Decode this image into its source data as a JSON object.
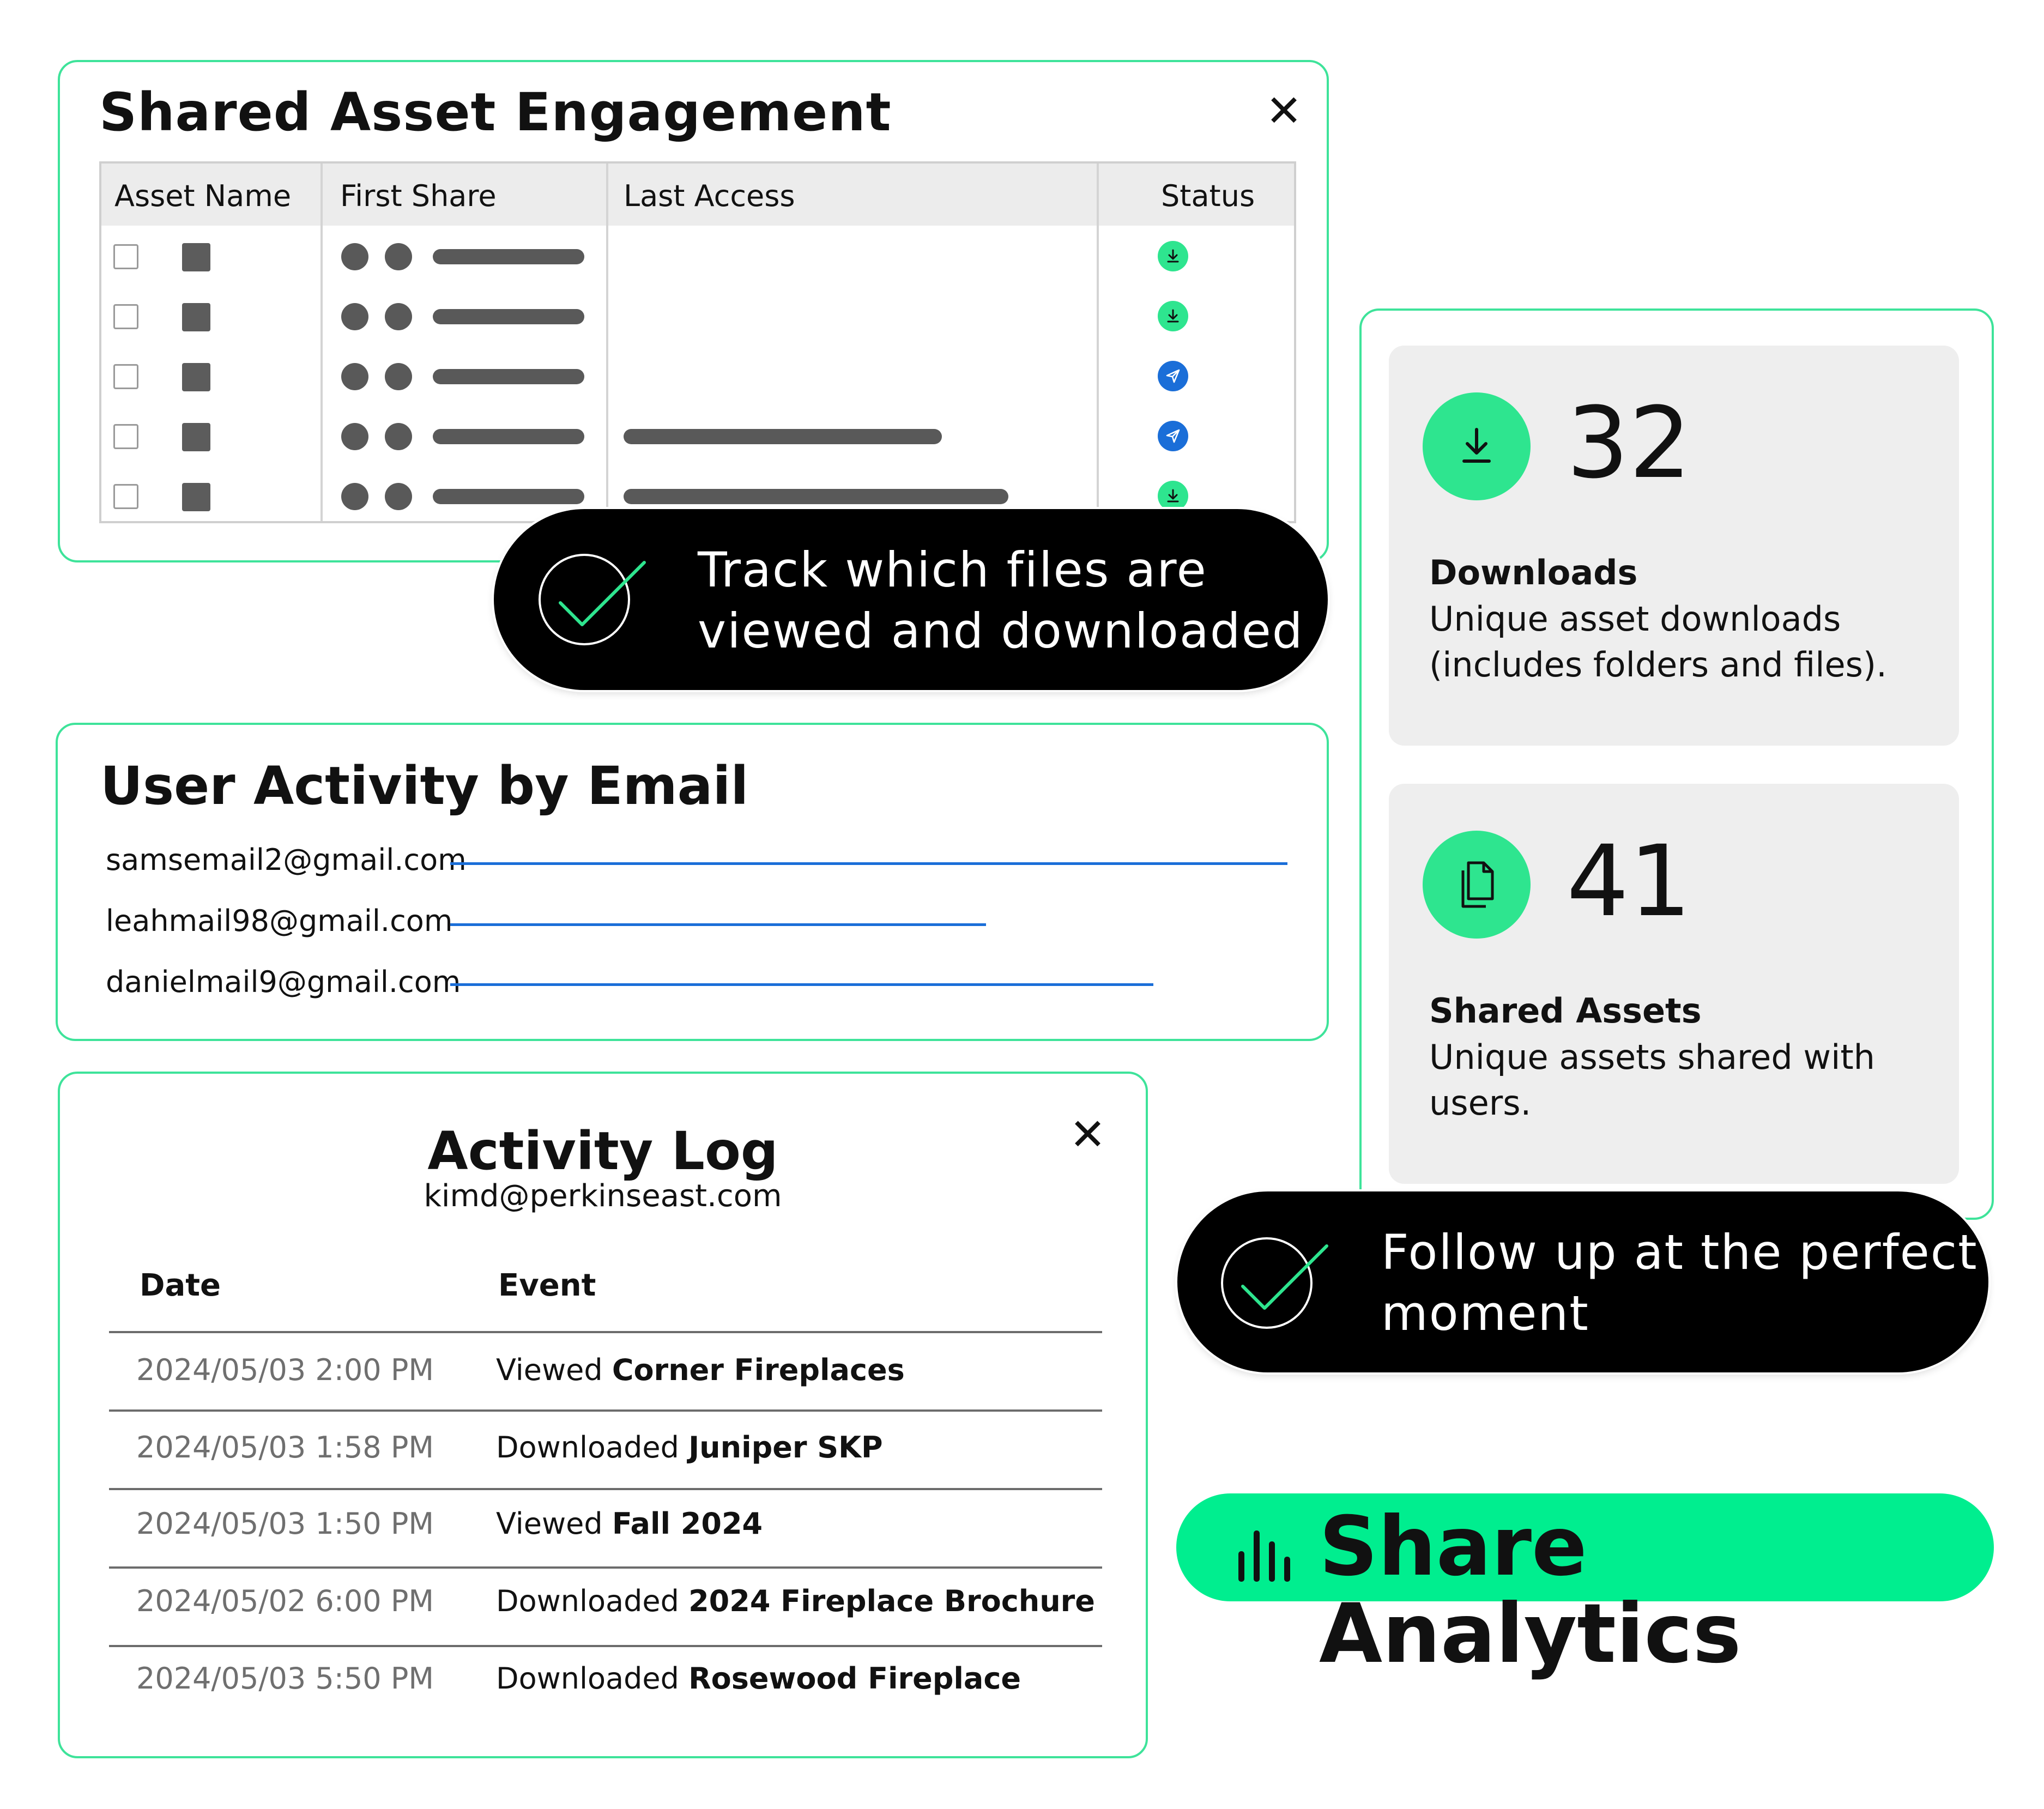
{
  "engagement": {
    "title": "Shared Asset Engagement",
    "columns": [
      "Asset Name",
      "First Share",
      "Last Access",
      "Status"
    ],
    "rows": [
      {
        "status": "download"
      },
      {
        "status": "download"
      },
      {
        "status": "sent"
      },
      {
        "status": "sent"
      },
      {
        "status": "download"
      }
    ],
    "close_icon": "close-icon"
  },
  "callout_tracking": {
    "line1": "Track which files are",
    "line2": "viewed and downloaded"
  },
  "user_activity": {
    "title": "User Activity by Email",
    "emails": [
      {
        "email": "samsemail2@gmail.com",
        "activity": 1.0
      },
      {
        "email": "leahmail98@gmail.com",
        "activity": 0.64
      },
      {
        "email": "danielmail9@gmail.com",
        "activity": 0.84
      }
    ]
  },
  "activity_log": {
    "title": "Activity Log",
    "user": "kimd@perkinseast.com",
    "col_date": "Date",
    "col_event": "Event",
    "entries": [
      {
        "date": "2024/05/03 2:00 PM",
        "action": "Viewed",
        "asset": "Corner Fireplaces"
      },
      {
        "date": "2024/05/03 1:58 PM",
        "action": "Downloaded",
        "asset": "Juniper SKP"
      },
      {
        "date": "2024/05/03 1:50 PM",
        "action": "Viewed",
        "asset": "Fall 2024"
      },
      {
        "date": "2024/05/02 6:00 PM",
        "action": "Downloaded",
        "asset": "2024 Fireplace Brochure"
      },
      {
        "date": "2024/05/03 5:50 PM",
        "action": "Downloaded",
        "asset": "Rosewood Fireplace"
      }
    ]
  },
  "stats": {
    "downloads": {
      "value": "32",
      "title": "Downloads",
      "desc_line1": "Unique asset downloads",
      "desc_line2": "(includes folders and files).",
      "icon": "download-icon"
    },
    "shared": {
      "value": "41",
      "title": "Shared Assets",
      "desc_line1": "Unique assets shared with",
      "desc_line2": "users.",
      "icon": "document-copy-icon"
    }
  },
  "callout_followup": {
    "line1": "Follow up at the perfect",
    "line2": "moment"
  },
  "share_analytics": {
    "label": "Share Analytics",
    "icon": "bar-chart-icon"
  },
  "colors": {
    "accent_green": "#2ee58f",
    "border_green": "#3ee39a",
    "blue": "#1a6ed8"
  }
}
